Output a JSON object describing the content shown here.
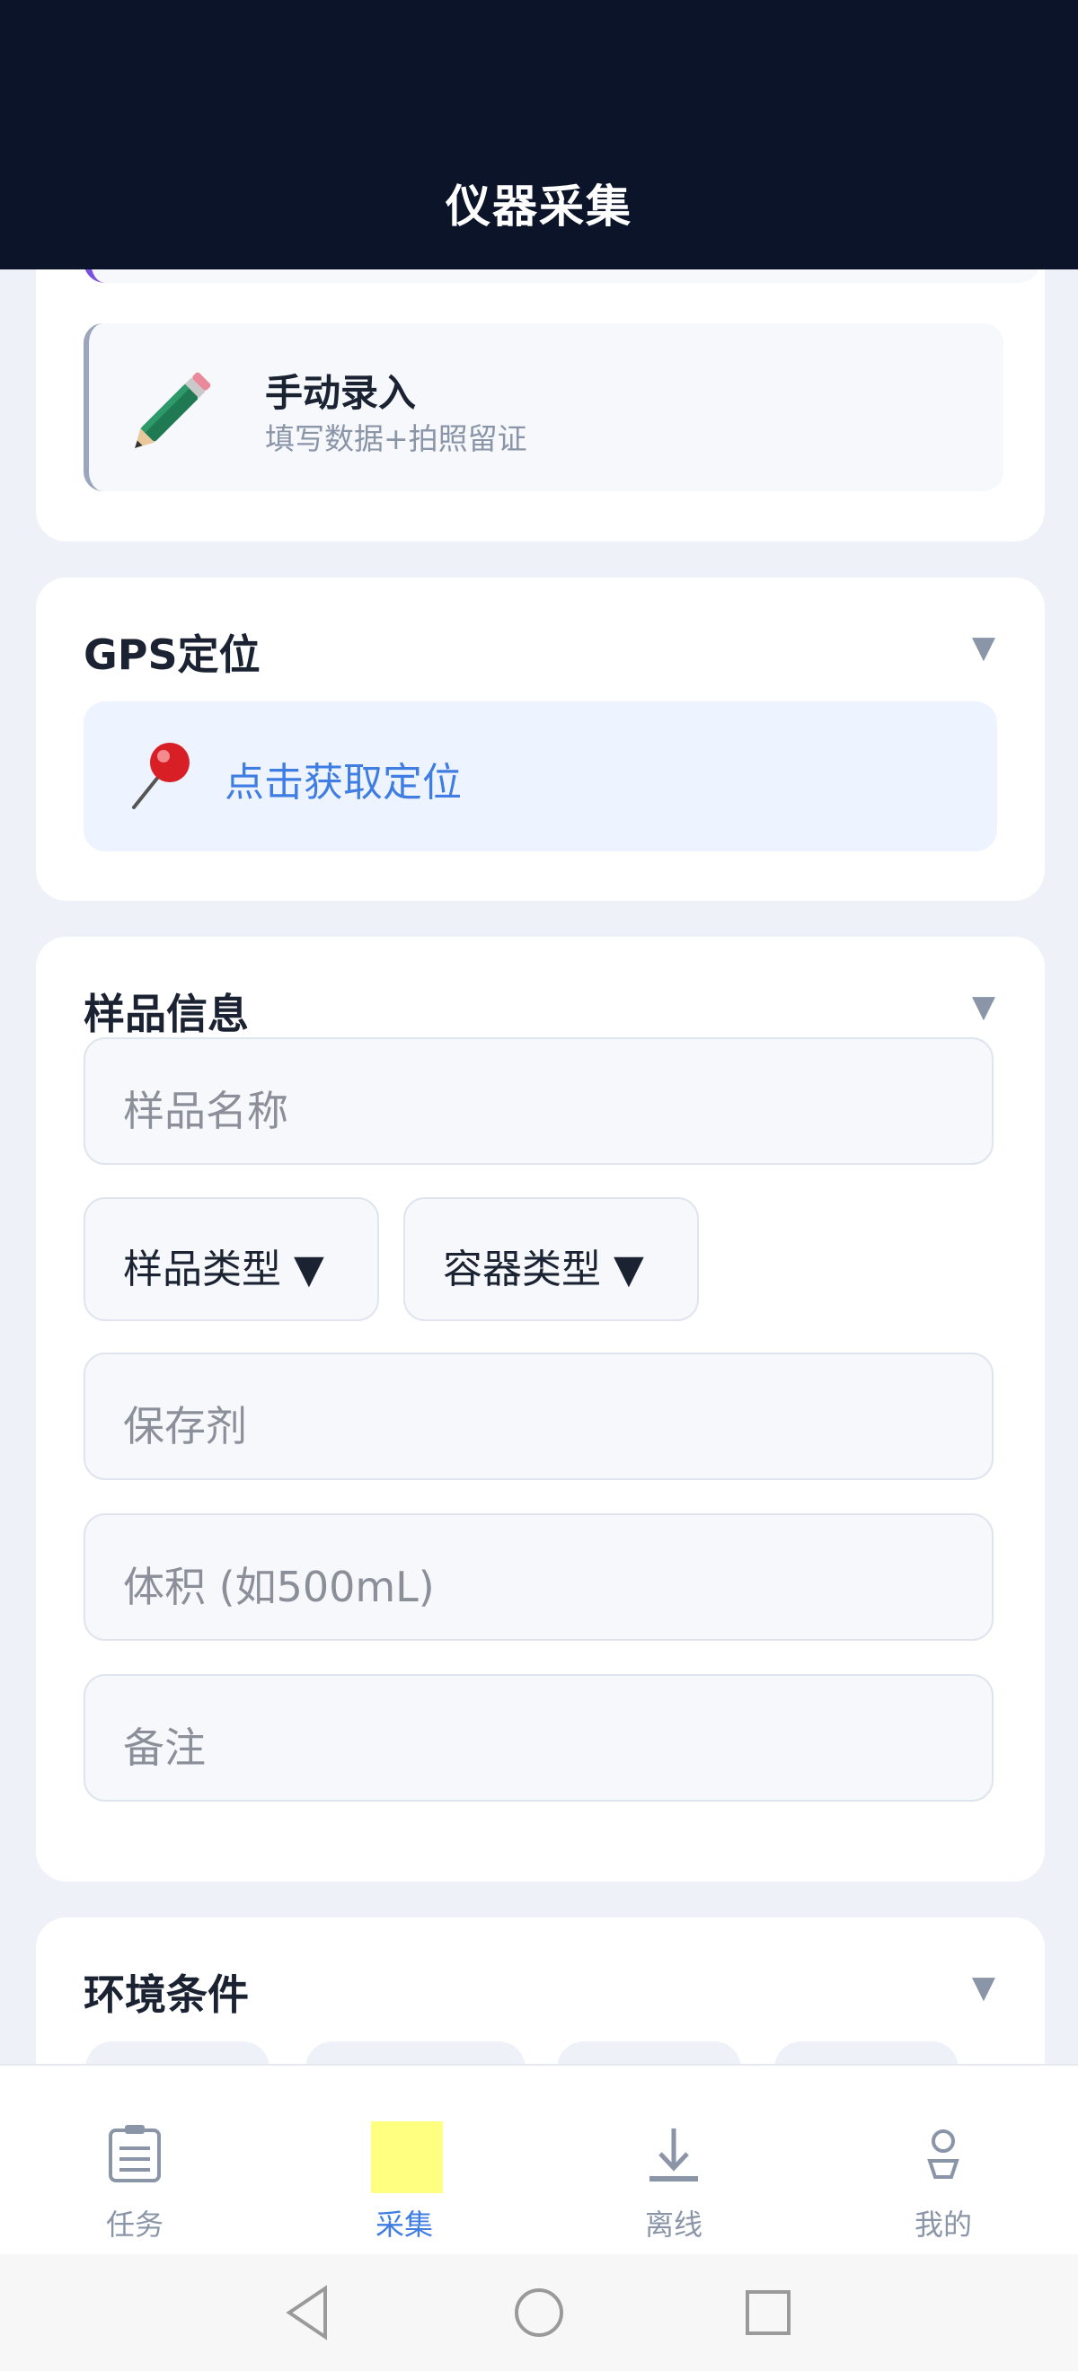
{
  "header": {
    "title": "仪器采集"
  },
  "capture_mode": {
    "items": [
      {
        "label": "手动录入",
        "desc": "填写数据+拍照留证",
        "icon": "pencil-icon"
      }
    ]
  },
  "gps": {
    "title": "GPS定位",
    "button_label": "点击获取定位",
    "icon": "pin-icon"
  },
  "sample": {
    "title": "样品信息",
    "fields": [
      {
        "placeholder": "样品名称"
      },
      {
        "placeholder": "保存剂"
      },
      {
        "placeholder": "体积 (如500mL)"
      },
      {
        "placeholder": "备注"
      }
    ],
    "selects": [
      {
        "label": "样品类型 ▼"
      },
      {
        "label": "容器类型 ▼"
      }
    ]
  },
  "environment": {
    "title": "环境条件"
  },
  "tabbar": {
    "tabs": [
      {
        "label": "任务",
        "icon": "task-list-icon",
        "active": false
      },
      {
        "label": "采集",
        "icon": "collect-icon",
        "active": true
      },
      {
        "label": "离线",
        "icon": "download-icon",
        "active": false
      },
      {
        "label": "我的",
        "icon": "user-icon",
        "active": false
      }
    ]
  },
  "colors": {
    "header_bg": "#0b1429",
    "accent_blue": "#3f7de3",
    "accent_purple": "#7a4fe0",
    "highlight": "#ffff80"
  }
}
